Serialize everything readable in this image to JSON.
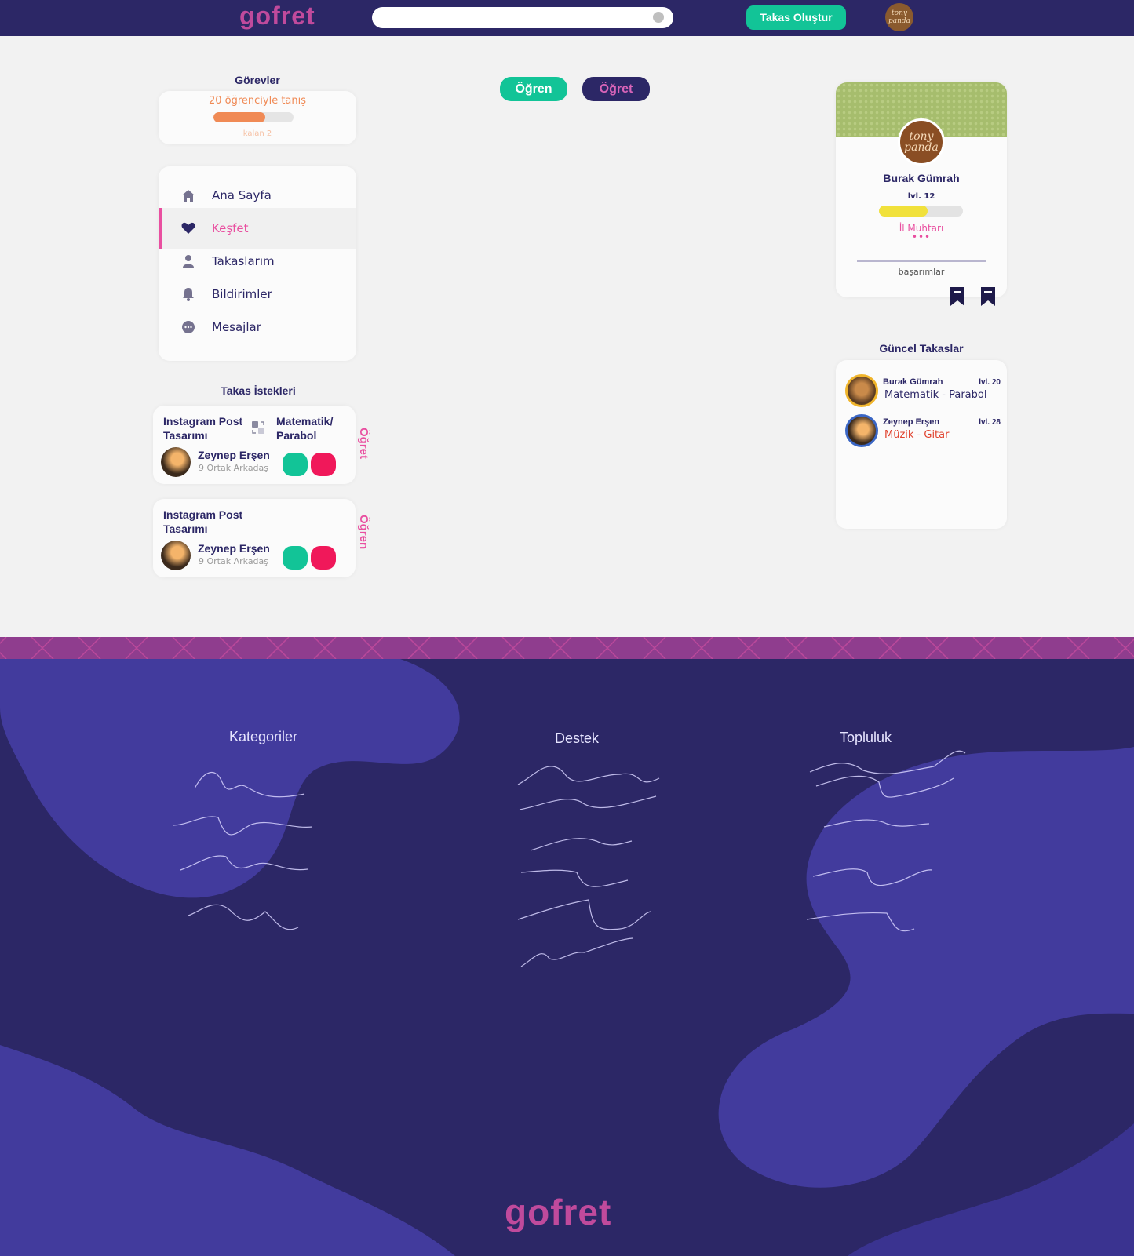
{
  "header": {
    "logo": "gofret",
    "search_placeholder": "",
    "create_button": "Takas Oluştur",
    "avatar_text": "tony panda"
  },
  "tasks": {
    "title": "Görevler",
    "task": "20 öğrenciyle tanış",
    "progress_percent": 65,
    "remaining": "kalan 2"
  },
  "nav": {
    "items": [
      {
        "label": "Ana Sayfa",
        "icon": "home-icon"
      },
      {
        "label": "Keşfet",
        "icon": "heart-icon",
        "active": true
      },
      {
        "label": "Takaslarım",
        "icon": "user-icon"
      },
      {
        "label": "Bildirimler",
        "icon": "bell-icon"
      },
      {
        "label": "Mesajlar",
        "icon": "chat-icon"
      }
    ]
  },
  "requests": {
    "title": "Takas İstekleri",
    "items": [
      {
        "offer_line1": "Instagram Post",
        "offer_line2": "Tasarımı",
        "want_line1": "Matematik/",
        "want_line2": "Parabol",
        "name": "Zeynep Erşen",
        "mutual": "9 Ortak Arkadaş",
        "side_label": "Öğret"
      },
      {
        "offer_line1": "Instagram Post",
        "offer_line2": "Tasarımı",
        "name": "Zeynep Erşen",
        "mutual": "9 Ortak Arkadaş",
        "side_label": "Öğren"
      }
    ]
  },
  "toggle": {
    "learn": "Öğren",
    "teach": "Öğret"
  },
  "profile": {
    "avatar_text": "tony panda",
    "name": "Burak Gümrah",
    "level": "lvl. 12",
    "xp_percent": 58,
    "title": "İl Muhtarı",
    "dots": "•••",
    "achievements": "başarımlar"
  },
  "recent": {
    "title": "Güncel Takaslar",
    "items": [
      {
        "name": "Burak Gümrah",
        "level": "lvl. 20",
        "skill": "Matematik - Parabol",
        "skill_color": "#2c2766"
      },
      {
        "name": "Zeynep Erşen",
        "level": "lvl. 28",
        "skill": "Müzik - Gitar",
        "skill_color": "#e0432f"
      }
    ]
  },
  "footer": {
    "col1": "Kategoriler",
    "col2": "Destek",
    "col3": "Topluluk",
    "logo": "gofret"
  },
  "colors": {
    "navy": "#2c2766",
    "green": "#12c497",
    "pink": "#e94fa0",
    "red": "#f0185a",
    "orange": "#f08a55",
    "yellow": "#f1e13b",
    "footer_blob": "#423b9d",
    "stripe": "#8f3d8e"
  }
}
